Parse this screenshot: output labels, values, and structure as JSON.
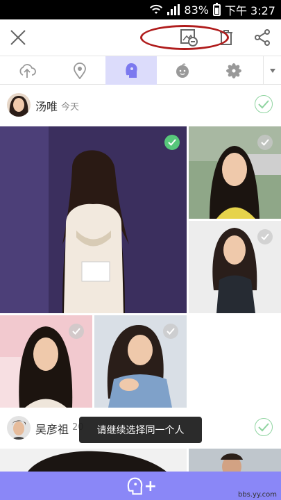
{
  "status_bar": {
    "battery_percent": "83%",
    "battery_level": 0.83,
    "time": "下午 3:27"
  },
  "toolbar": {
    "close_icon": "close-icon",
    "remove_photo_icon": "image-remove-icon",
    "delete_icon": "trash-icon",
    "share_icon": "share-icon",
    "highlight_color": "#b01c1c"
  },
  "tabs": [
    {
      "icon": "cloud-upload-icon",
      "active": false
    },
    {
      "icon": "location-pin-icon",
      "active": false
    },
    {
      "icon": "face-icon",
      "active": true
    },
    {
      "icon": "baby-icon",
      "active": false
    },
    {
      "icon": "flower-icon",
      "active": false
    }
  ],
  "groups": [
    {
      "name": "汤唯",
      "date": "今天",
      "selected": true
    },
    {
      "name": "吴彦祖",
      "date": "20",
      "selected": true
    }
  ],
  "photos": [
    {
      "selected": true
    },
    {
      "selected": false
    },
    {
      "selected": false
    },
    {
      "selected": false
    },
    {
      "selected": false
    }
  ],
  "toast": {
    "text": "请继续选择同一个人"
  },
  "bottom_bar": {
    "add_person_icon": "add-person-icon",
    "plus": "+",
    "watermark": "bbs.yy.com",
    "color": "#8a87f7"
  },
  "colors": {
    "accent": "#8a87f7",
    "active_tab": "#dcdcfb",
    "check_green": "#57c77b"
  }
}
